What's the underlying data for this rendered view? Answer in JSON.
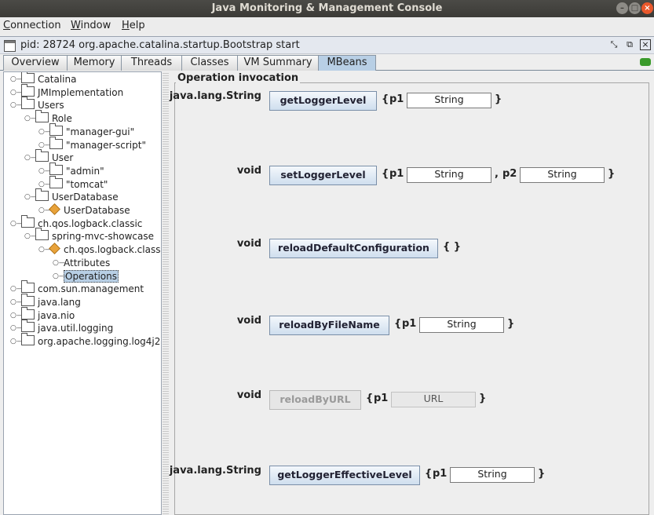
{
  "window": {
    "title": "Java Monitoring & Management Console"
  },
  "menubar": {
    "items": [
      "Connection",
      "Window",
      "Help"
    ]
  },
  "frame": {
    "title": "pid: 28724 org.apache.catalina.startup.Bootstrap start"
  },
  "tabs": [
    "Overview",
    "Memory",
    "Threads",
    "Classes",
    "VM Summary",
    "MBeans"
  ],
  "active_tab": "MBeans",
  "tree": [
    {
      "label": "Catalina",
      "type": "folder",
      "level": 0
    },
    {
      "label": "JMImplementation",
      "type": "folder",
      "level": 0
    },
    {
      "label": "Users",
      "type": "folder",
      "level": 0
    },
    {
      "label": "Role",
      "type": "folder",
      "level": 1
    },
    {
      "label": "\"manager-gui\"",
      "type": "folder",
      "level": 2
    },
    {
      "label": "\"manager-script\"",
      "type": "folder",
      "level": 2
    },
    {
      "label": "User",
      "type": "folder",
      "level": 1
    },
    {
      "label": "\"admin\"",
      "type": "folder",
      "level": 2
    },
    {
      "label": "\"tomcat\"",
      "type": "folder",
      "level": 2
    },
    {
      "label": "UserDatabase",
      "type": "folder",
      "level": 1
    },
    {
      "label": "UserDatabase",
      "type": "bean",
      "level": 2
    },
    {
      "label": "ch.qos.logback.classic",
      "type": "folder",
      "level": 0
    },
    {
      "label": "spring-mvc-showcase",
      "type": "folder",
      "level": 1
    },
    {
      "label": "ch.qos.logback.classi",
      "type": "bean",
      "level": 2
    },
    {
      "label": "Attributes",
      "type": "leaf",
      "level": 3
    },
    {
      "label": "Operations",
      "type": "leaf",
      "level": 3,
      "selected": true
    },
    {
      "label": "com.sun.management",
      "type": "folder",
      "level": 0
    },
    {
      "label": "java.lang",
      "type": "folder",
      "level": 0
    },
    {
      "label": "java.nio",
      "type": "folder",
      "level": 0
    },
    {
      "label": "java.util.logging",
      "type": "folder",
      "level": 0
    },
    {
      "label": "org.apache.logging.log4j2",
      "type": "folder",
      "level": 0
    }
  ],
  "operations_panel": {
    "title": "Operation invocation",
    "operations": [
      {
        "return_type": "java.lang.String",
        "name": "getLoggerLevel",
        "enabled": true,
        "params": [
          {
            "label": "p1",
            "type": "String"
          }
        ]
      },
      {
        "return_type": "void",
        "name": "setLoggerLevel",
        "enabled": true,
        "params": [
          {
            "label": "p1",
            "type": "String"
          },
          {
            "label": "p2",
            "type": "String"
          }
        ]
      },
      {
        "return_type": "void",
        "name": "reloadDefaultConfiguration",
        "enabled": true,
        "params": []
      },
      {
        "return_type": "void",
        "name": "reloadByFileName",
        "enabled": true,
        "params": [
          {
            "label": "p1",
            "type": "String"
          }
        ]
      },
      {
        "return_type": "void",
        "name": "reloadByURL",
        "enabled": false,
        "params": [
          {
            "label": "p1",
            "type": "URL"
          }
        ]
      },
      {
        "return_type": "java.lang.String",
        "name": "getLoggerEffectiveLevel",
        "enabled": true,
        "params": [
          {
            "label": "p1",
            "type": "String"
          }
        ]
      }
    ]
  },
  "punctuation": {
    "open": "{",
    "close": "}",
    "empty": "{ }",
    "comma": ","
  },
  "colors": {
    "title_bar": "#3c3b37",
    "selection": "#b8cfe5",
    "close_button": "#e9582c",
    "connection_indicator": "#3a9a2a"
  }
}
